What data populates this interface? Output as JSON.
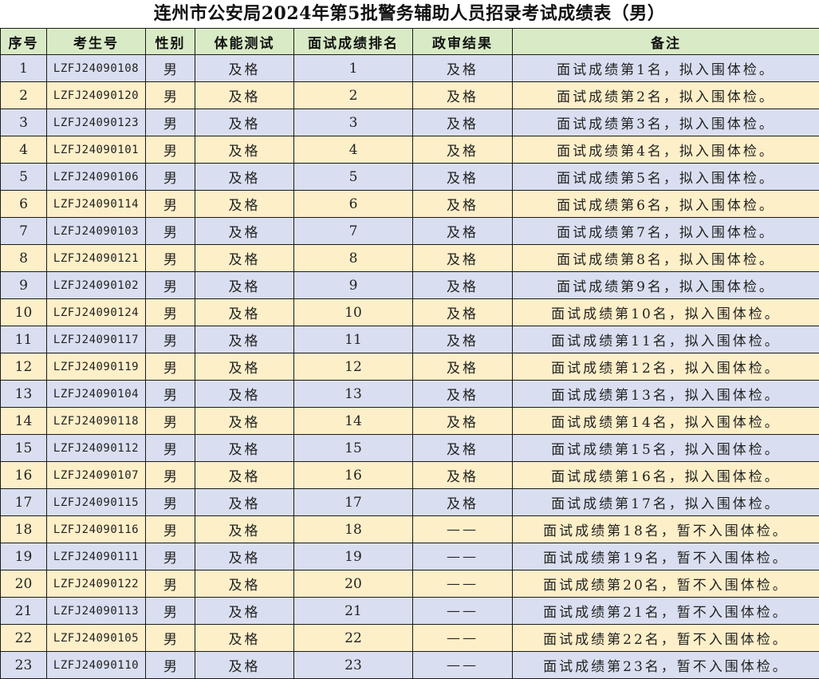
{
  "title": "连州市公安局2024年第5批警务辅助人员招录考试成绩表（男）",
  "headers": [
    "序号",
    "考生号",
    "性别",
    "体能测试",
    "面试成绩排名",
    "政审结果",
    "备注"
  ],
  "rows": [
    [
      "1",
      "LZFJ24090108",
      "男",
      "及格",
      "1",
      "及格",
      "面试成绩第1名，拟入围体检。"
    ],
    [
      "2",
      "LZFJ24090120",
      "男",
      "及格",
      "2",
      "及格",
      "面试成绩第2名，拟入围体检。"
    ],
    [
      "3",
      "LZFJ24090123",
      "男",
      "及格",
      "3",
      "及格",
      "面试成绩第3名，拟入围体检。"
    ],
    [
      "4",
      "LZFJ24090101",
      "男",
      "及格",
      "4",
      "及格",
      "面试成绩第4名，拟入围体检。"
    ],
    [
      "5",
      "LZFJ24090106",
      "男",
      "及格",
      "5",
      "及格",
      "面试成绩第5名，拟入围体检。"
    ],
    [
      "6",
      "LZFJ24090114",
      "男",
      "及格",
      "6",
      "及格",
      "面试成绩第6名，拟入围体检。"
    ],
    [
      "7",
      "LZFJ24090103",
      "男",
      "及格",
      "7",
      "及格",
      "面试成绩第7名，拟入围体检。"
    ],
    [
      "8",
      "LZFJ24090121",
      "男",
      "及格",
      "8",
      "及格",
      "面试成绩第8名，拟入围体检。"
    ],
    [
      "9",
      "LZFJ24090102",
      "男",
      "及格",
      "9",
      "及格",
      "面试成绩第9名，拟入围体检。"
    ],
    [
      "10",
      "LZFJ24090124",
      "男",
      "及格",
      "10",
      "及格",
      "面试成绩第10名，拟入围体检。"
    ],
    [
      "11",
      "LZFJ24090117",
      "男",
      "及格",
      "11",
      "及格",
      "面试成绩第11名，拟入围体检。"
    ],
    [
      "12",
      "LZFJ24090119",
      "男",
      "及格",
      "12",
      "及格",
      "面试成绩第12名，拟入围体检。"
    ],
    [
      "13",
      "LZFJ24090104",
      "男",
      "及格",
      "13",
      "及格",
      "面试成绩第13名，拟入围体检。"
    ],
    [
      "14",
      "LZFJ24090118",
      "男",
      "及格",
      "14",
      "及格",
      "面试成绩第14名，拟入围体检。"
    ],
    [
      "15",
      "LZFJ24090112",
      "男",
      "及格",
      "15",
      "及格",
      "面试成绩第15名，拟入围体检。"
    ],
    [
      "16",
      "LZFJ24090107",
      "男",
      "及格",
      "16",
      "及格",
      "面试成绩第16名，拟入围体检。"
    ],
    [
      "17",
      "LZFJ24090115",
      "男",
      "及格",
      "17",
      "及格",
      "面试成绩第17名，拟入围体检。"
    ],
    [
      "18",
      "LZFJ24090116",
      "男",
      "及格",
      "18",
      "——",
      "面试成绩第18名，暂不入围体检。"
    ],
    [
      "19",
      "LZFJ24090111",
      "男",
      "及格",
      "19",
      "——",
      "面试成绩第19名，暂不入围体检。"
    ],
    [
      "20",
      "LZFJ24090122",
      "男",
      "及格",
      "20",
      "——",
      "面试成绩第20名，暂不入围体检。"
    ],
    [
      "21",
      "LZFJ24090113",
      "男",
      "及格",
      "21",
      "——",
      "面试成绩第21名，暂不入围体检。"
    ],
    [
      "22",
      "LZFJ24090105",
      "男",
      "及格",
      "22",
      "——",
      "面试成绩第22名，暂不入围体检。"
    ],
    [
      "23",
      "LZFJ24090110",
      "男",
      "及格",
      "23",
      "——",
      "面试成绩第23名，暂不入围体检。"
    ]
  ],
  "colors": {
    "header_bg": "#d9ebc6",
    "row_odd_bg": "#d9dff0",
    "row_even_bg": "#fdefc8"
  }
}
